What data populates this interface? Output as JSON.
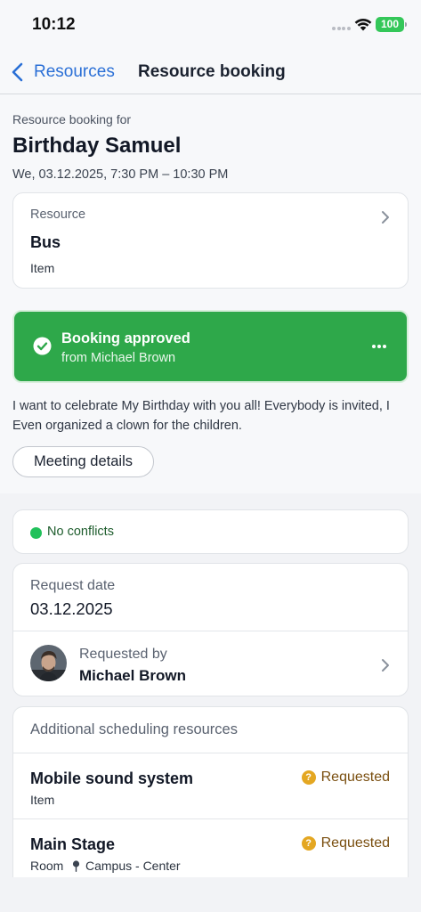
{
  "status_bar": {
    "time": "10:12",
    "battery": "100"
  },
  "nav": {
    "back_label": "Resources",
    "title": "Resource booking"
  },
  "booking": {
    "for_label": "Resource booking for",
    "event_title": "Birthday Samuel",
    "datetime": "We, 03.12.2025, 7:30 PM – 10:30 PM"
  },
  "resource": {
    "label": "Resource",
    "name": "Bus",
    "type": "Item"
  },
  "approval": {
    "title": "Booking approved",
    "from": "from Michael Brown",
    "color": "#2ea84a"
  },
  "description": "I want to celebrate My Birthday with you all! Everybody is invited, I Even organized a clown for the children.",
  "details_button": "Meeting details",
  "conflicts": {
    "text": "No conflicts",
    "color": "#21c15b"
  },
  "request": {
    "date_label": "Request date",
    "date_value": "03.12.2025",
    "by_label": "Requested by",
    "by_name": "Michael Brown"
  },
  "additional": {
    "header": "Additional scheduling resources",
    "items": [
      {
        "name": "Mobile sound system",
        "type": "Item",
        "location": "",
        "status": "Requested"
      },
      {
        "name": "Main Stage",
        "type": "Room",
        "location": "Campus - Center",
        "status": "Requested"
      }
    ]
  },
  "icons": {
    "back": "chevron-left-icon",
    "chevron": "chevron-right-icon",
    "approved": "check-circle-icon",
    "more": "more-horizontal-icon",
    "status": "question-circle-icon",
    "location": "pin-icon"
  }
}
